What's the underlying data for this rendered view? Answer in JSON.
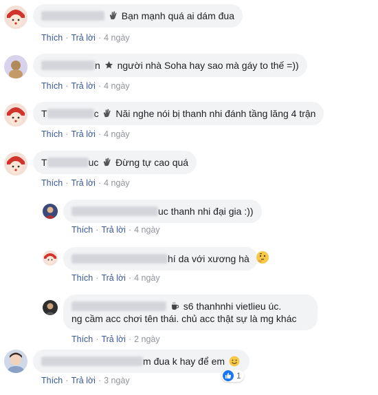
{
  "actions": {
    "like": "Thích",
    "reply": "Trả lời"
  },
  "comments": [
    {
      "name_prefix": "",
      "name_suffix": "",
      "text": "Bạn mạnh quá ai dám đua",
      "time": "4 ngày"
    },
    {
      "name_prefix": "",
      "name_suffix": "n",
      "text": "người nhà Soha hay sao mà gáy to thế =))",
      "time": "4 ngày"
    },
    {
      "name_prefix": "T",
      "name_suffix": "c",
      "text": "Năi nghe nói bị thanh nhi đánh tầng lăng 4 trận",
      "time": "4 ngày"
    },
    {
      "name_prefix": "T",
      "name_suffix": "uc",
      "text": "Đừng tự cao quá",
      "time": "4 ngày"
    },
    {
      "name_prefix": "",
      "name_suffix": "uc",
      "text": "thanh nhi đại gia :))",
      "time": "4 ngày"
    },
    {
      "name_prefix": "",
      "name_suffix": "hí",
      "text": "da với xương hà",
      "time": "4 ngày"
    },
    {
      "name_prefix": "",
      "name_suffix": "",
      "text_line1": "s6 thanhnhi vietlieu úc.",
      "text_line2": "ng cầm acc chơi tên thái. chủ acc thật sự là mg khác",
      "time": "2 ngày"
    },
    {
      "name_prefix": "",
      "name_suffix": "m",
      "text": "đua k hay để em",
      "time": "3 ngày",
      "reaction_count": "1"
    }
  ],
  "icons": [
    "hand-wave-icon",
    "star-icon",
    "thinking-face-icon",
    "coffee-icon",
    "smiley-face-icon",
    "like-icon"
  ],
  "colors": {
    "bubble": "#f2f3f5",
    "link": "#385898",
    "time": "#90949c",
    "like_blue": "#1877f2"
  }
}
